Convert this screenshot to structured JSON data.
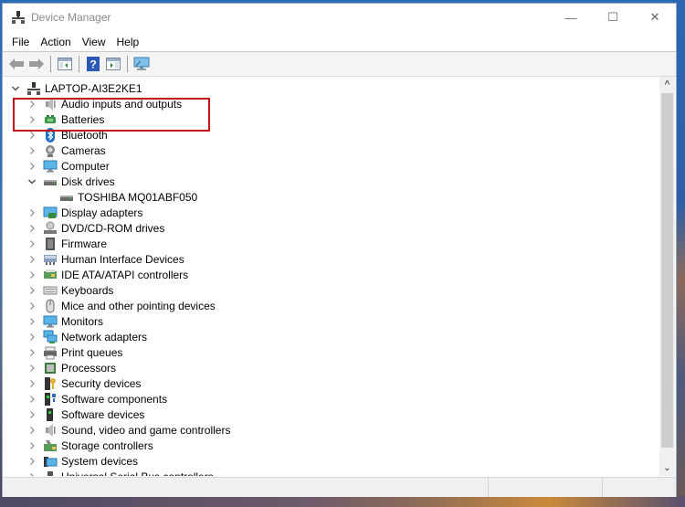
{
  "window": {
    "title": "Device Manager",
    "controls": {
      "minimize": "—",
      "maximize": "☐",
      "close": "✕"
    }
  },
  "menu": [
    {
      "label": "File"
    },
    {
      "label": "Action"
    },
    {
      "label": "View"
    },
    {
      "label": "Help"
    }
  ],
  "toolbar": [
    {
      "name": "back-button",
      "icon": "back-arrow-icon"
    },
    {
      "name": "forward-button",
      "icon": "forward-arrow-icon"
    },
    {
      "name": "show-hide-console-tree-button",
      "icon": "console-tree-icon"
    },
    {
      "name": "help-button",
      "icon": "help-icon"
    },
    {
      "name": "show-hide-action-pane-button",
      "icon": "action-pane-icon"
    },
    {
      "name": "scan-hardware-button",
      "icon": "monitor-scan-icon"
    }
  ],
  "tree": {
    "root": {
      "label": "LAPTOP-AI3E2KE1",
      "expanded": true,
      "icon": "computer-tree-icon"
    },
    "categories": [
      {
        "label": "Audio inputs and outputs",
        "icon": "speaker-icon",
        "expanded": false
      },
      {
        "label": "Batteries",
        "icon": "battery-icon",
        "expanded": false
      },
      {
        "label": "Bluetooth",
        "icon": "bluetooth-icon",
        "expanded": false
      },
      {
        "label": "Cameras",
        "icon": "camera-icon",
        "expanded": false
      },
      {
        "label": "Computer",
        "icon": "monitor-icon",
        "expanded": false
      },
      {
        "label": "Disk drives",
        "icon": "disk-drive-icon",
        "expanded": true,
        "highlighted": true,
        "children": [
          {
            "label": "TOSHIBA MQ01ABF050",
            "icon": "disk-drive-icon"
          }
        ]
      },
      {
        "label": "Display adapters",
        "icon": "display-adapter-icon",
        "expanded": false
      },
      {
        "label": "DVD/CD-ROM drives",
        "icon": "dvd-drive-icon",
        "expanded": false
      },
      {
        "label": "Firmware",
        "icon": "firmware-icon",
        "expanded": false
      },
      {
        "label": "Human Interface Devices",
        "icon": "hid-icon",
        "expanded": false
      },
      {
        "label": "IDE ATA/ATAPI controllers",
        "icon": "ide-controller-icon",
        "expanded": false
      },
      {
        "label": "Keyboards",
        "icon": "keyboard-icon",
        "expanded": false
      },
      {
        "label": "Mice and other pointing devices",
        "icon": "mouse-icon",
        "expanded": false
      },
      {
        "label": "Monitors",
        "icon": "monitor-icon",
        "expanded": false
      },
      {
        "label": "Network adapters",
        "icon": "network-adapter-icon",
        "expanded": false
      },
      {
        "label": "Print queues",
        "icon": "printer-icon",
        "expanded": false
      },
      {
        "label": "Processors",
        "icon": "processor-icon",
        "expanded": false
      },
      {
        "label": "Security devices",
        "icon": "security-key-icon",
        "expanded": false
      },
      {
        "label": "Software components",
        "icon": "software-component-icon",
        "expanded": false
      },
      {
        "label": "Software devices",
        "icon": "software-device-icon",
        "expanded": false
      },
      {
        "label": "Sound, video and game controllers",
        "icon": "speaker-icon",
        "expanded": false
      },
      {
        "label": "Storage controllers",
        "icon": "storage-controller-icon",
        "expanded": false
      },
      {
        "label": "System devices",
        "icon": "system-devices-icon",
        "expanded": false
      },
      {
        "label": "Universal Serial Bus controllers",
        "icon": "usb-icon",
        "expanded": false
      }
    ]
  },
  "colors": {
    "highlight_border": "#c4141b",
    "title_text": "#8a8a8a"
  }
}
